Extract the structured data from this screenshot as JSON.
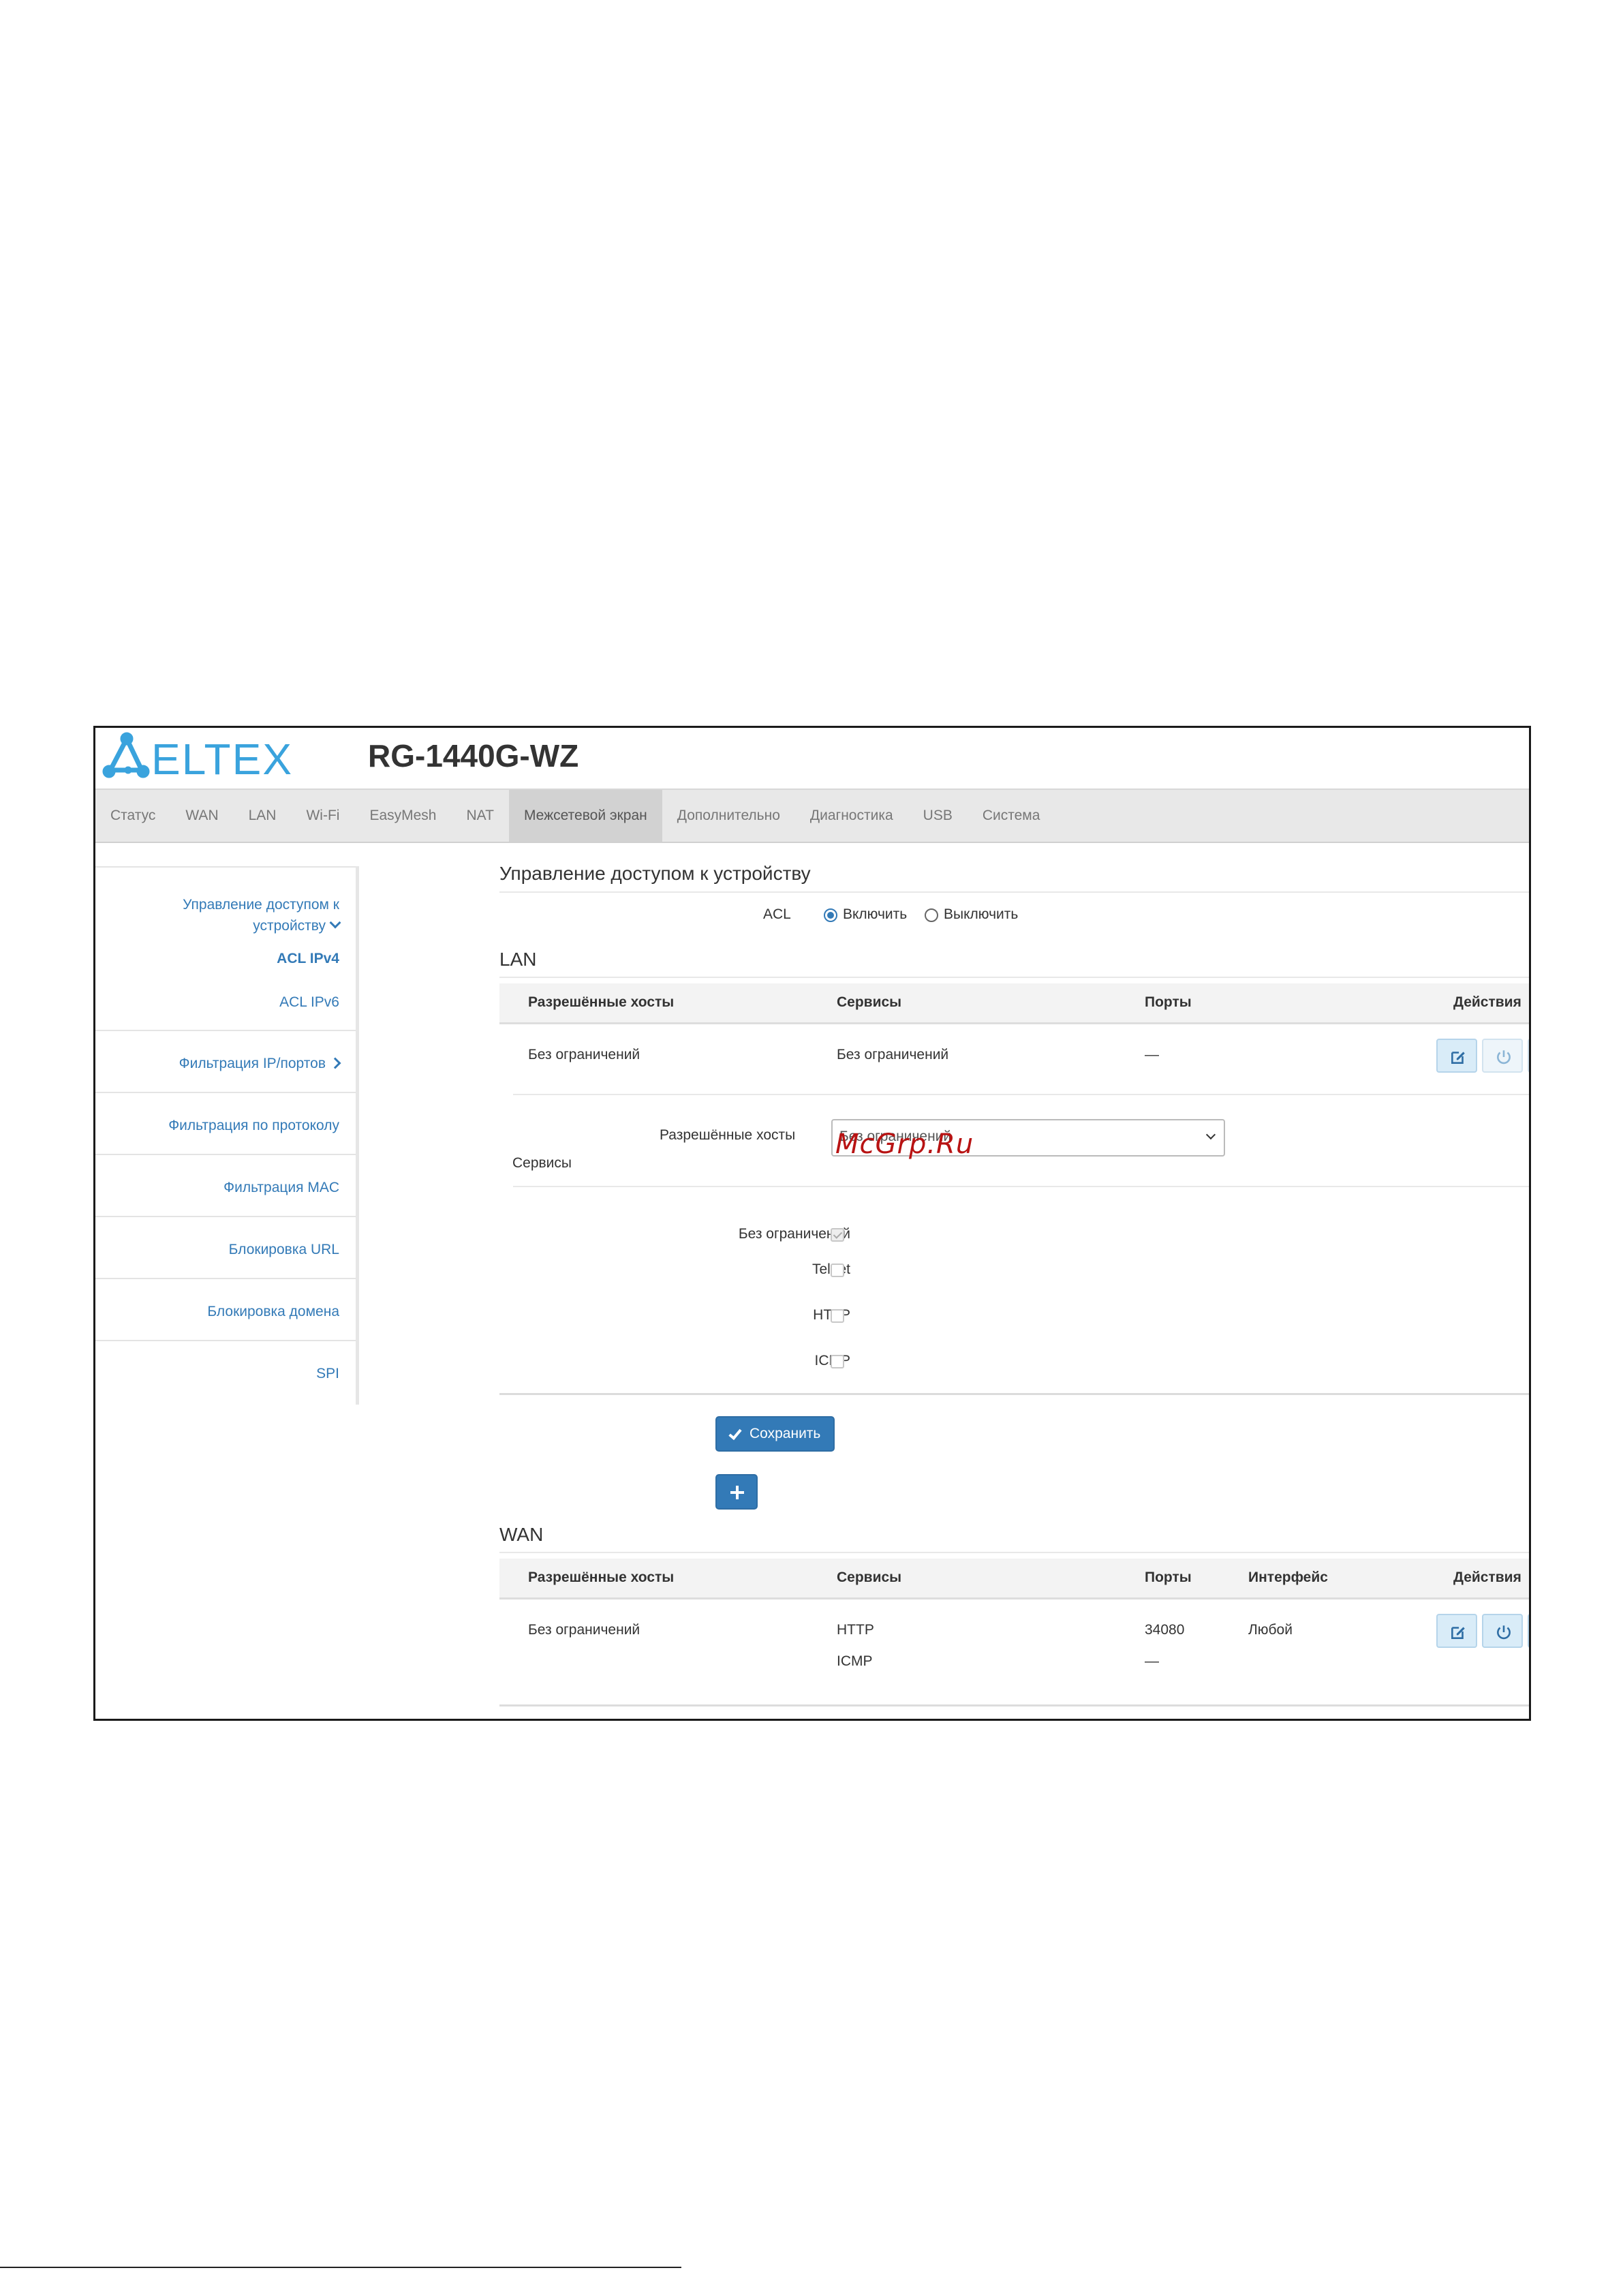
{
  "header": {
    "brand": "ELTEX",
    "model": "RG-1440G-WZ"
  },
  "topnav": [
    "Статус",
    "WAN",
    "LAN",
    "Wi-Fi",
    "EasyMesh",
    "NAT",
    "Межсетевой экран",
    "Дополнительно",
    "Диагностика",
    "USB",
    "Система"
  ],
  "topnav_active": "Межсетевой экран",
  "sidebar": {
    "access_control": "Управление доступом к устройству",
    "acl_ipv4": "ACL IPv4",
    "acl_ipv6": "ACL IPv6",
    "ip_port_filter": "Фильтрация IP/портов",
    "protocol_filter": "Фильтрация по протоколу",
    "mac_filter": "Фильтрация MAC",
    "url_block": "Блокировка URL",
    "domain_block": "Блокировка домена",
    "spi": "SPI"
  },
  "main": {
    "title": "Управление доступом к устройству",
    "acl_label": "ACL",
    "acl_on": "Включить",
    "acl_off": "Выключить",
    "acl_value": "on",
    "lan": {
      "heading": "LAN",
      "columns": {
        "hosts": "Разрешённые хосты",
        "services": "Сервисы",
        "ports": "Порты",
        "actions": "Действия"
      },
      "row": {
        "hosts": "Без ограничений",
        "services": "Без ограничений",
        "ports": "—"
      }
    },
    "form": {
      "hosts_label": "Разрешённые хосты",
      "hosts_value": "Без ограничений",
      "services_label": "Сервисы",
      "options": [
        {
          "label": "Без ограничений",
          "checked": true
        },
        {
          "label": "Telnet",
          "checked": false
        },
        {
          "label": "HTTP",
          "checked": false
        },
        {
          "label": "ICMP",
          "checked": false
        }
      ],
      "save": "Сохранить"
    },
    "wan": {
      "heading": "WAN",
      "columns": {
        "hosts": "Разрешённые хосты",
        "services": "Сервисы",
        "ports": "Порты",
        "iface": "Интерфейс",
        "actions": "Действия"
      },
      "row": {
        "hosts": "Без ограничений",
        "service1": "HTTP",
        "service2": "ICMP",
        "port1": "34080",
        "port2": "—",
        "iface": "Любой"
      }
    }
  },
  "watermark": "McGrp.Ru",
  "colors": {
    "accent": "#337ab7",
    "nav_bg": "#e8e8e8",
    "logo": "#3aa3dd"
  }
}
